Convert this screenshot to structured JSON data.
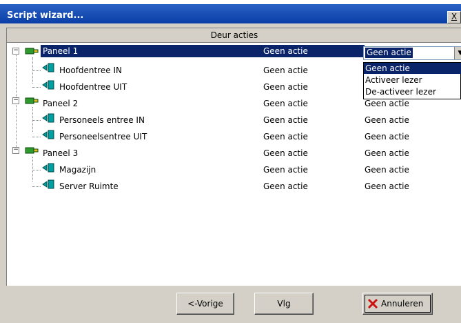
{
  "window": {
    "title": "Script wizard...",
    "close_glyph": "X"
  },
  "table": {
    "header": "Deur acties"
  },
  "tree": [
    {
      "label": "Paneel 1",
      "action": "Geen actie",
      "action2": "Geen actie",
      "type": "panel"
    },
    {
      "label": "Hoofdentree IN",
      "action": "Geen actie",
      "type": "door"
    },
    {
      "label": "Hoofdentree UIT",
      "action": "Geen actie",
      "type": "door"
    },
    {
      "label": "Paneel 2",
      "action": "Geen actie",
      "action2": "Geen actie",
      "type": "panel"
    },
    {
      "label": "Personeels entree IN",
      "action": "Geen actie",
      "action2": "Geen actie",
      "type": "door"
    },
    {
      "label": "Personeelsentree UIT",
      "action": "Geen actie",
      "action2": "Geen actie",
      "type": "door"
    },
    {
      "label": "Paneel 3",
      "action": "Geen actie",
      "action2": "Geen actie",
      "type": "panel"
    },
    {
      "label": "Magazijn",
      "action": "Geen actie",
      "action2": "Geen actie",
      "type": "door"
    },
    {
      "label": "Server Ruimte",
      "action": "Geen actie",
      "action2": "Geen actie",
      "type": "door"
    }
  ],
  "combo": {
    "value": "Geen actie"
  },
  "dropdown_options": [
    "Geen actie",
    "Activeer lezer",
    "De-activeer lezer"
  ],
  "buttons": {
    "prev": "<-Vorige",
    "next": "Vlg",
    "cancel": "Annuleren"
  },
  "colors": {
    "selection": "#0a246a",
    "panel_icon": "#2e9a2e",
    "door_icon": "#00a0a0",
    "cancel_icon": "#cc1111"
  }
}
